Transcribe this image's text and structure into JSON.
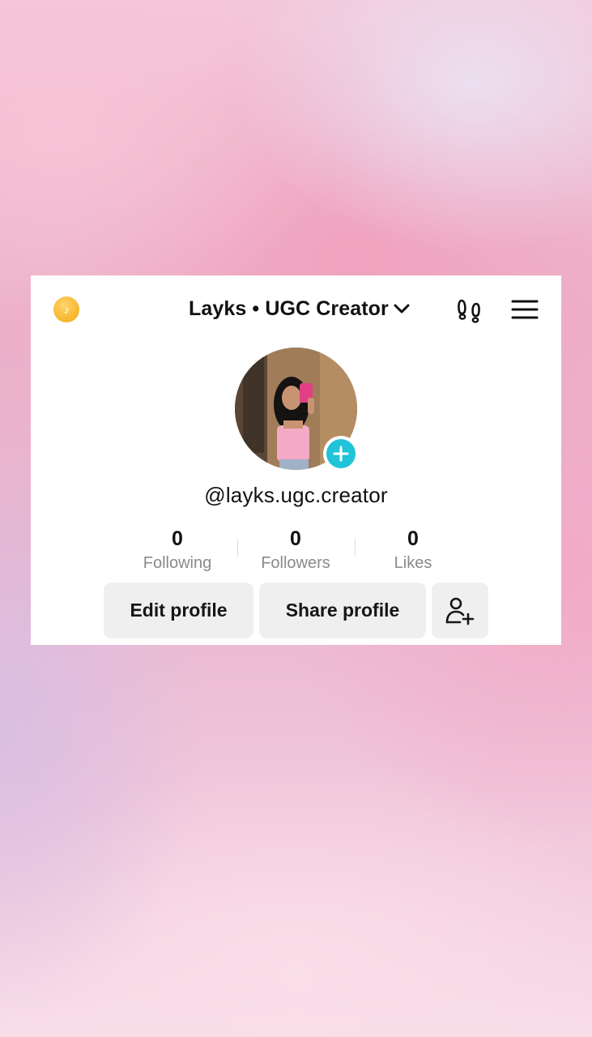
{
  "header": {
    "coin_glyph": "♪",
    "account_name": "Layks • UGC Creator",
    "icons": [
      "coin-icon",
      "chevron-down-icon",
      "footprints-icon",
      "hamburger-menu-icon"
    ]
  },
  "profile": {
    "username": "@layks.ugc.creator",
    "avatar_icon": "profile-photo",
    "add_icon": "plus-icon"
  },
  "stats": [
    {
      "value": "0",
      "label": "Following"
    },
    {
      "value": "0",
      "label": "Followers"
    },
    {
      "value": "0",
      "label": "Likes"
    }
  ],
  "actions": {
    "edit_label": "Edit profile",
    "share_label": "Share profile",
    "add_friend_icon": "add-friend-icon"
  },
  "colors": {
    "accent": "#20c4d9",
    "coin": "#f7b52b",
    "button_bg": "#efefef"
  }
}
